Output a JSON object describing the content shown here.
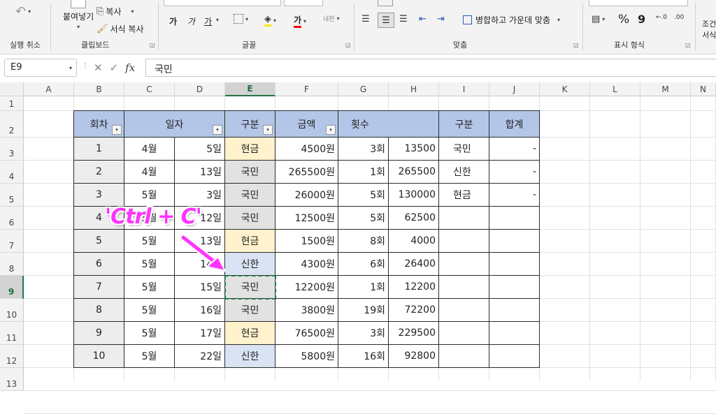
{
  "ribbon": {
    "undo_label": "실행 취소",
    "clipboard": {
      "paste_label": "붙여넣기",
      "copy_label": "복사",
      "format_painter_label": "서식 복사",
      "group_label": "클립보드"
    },
    "font": {
      "group_label": "글꼴",
      "bold_glyph": "가",
      "italic_glyph": "가",
      "underline_glyph": "가",
      "font_color_glyph": "가",
      "phonetic_glyph": "내천"
    },
    "alignment": {
      "group_label": "맞춤",
      "merge_label": "병합하고 가운데 맞춤"
    },
    "number": {
      "group_label": "표시 형식",
      "percent": "%",
      "comma": "9"
    },
    "styles": {
      "label_top": "조건",
      "label_bottom": "서식"
    },
    "colors": {
      "accent": "#217346",
      "font_red": "#ff0000"
    }
  },
  "formula_bar": {
    "name_box": "E9",
    "formula": "국민",
    "fx": "fx"
  },
  "columns": [
    "A",
    "B",
    "C",
    "D",
    "E",
    "F",
    "G",
    "H",
    "I",
    "J",
    "K",
    "L",
    "M",
    "N"
  ],
  "rows": [
    "1",
    "2",
    "3",
    "4",
    "5",
    "6",
    "7",
    "8",
    "9",
    "10",
    "11",
    "12",
    "13"
  ],
  "selected_cell": {
    "column": "E",
    "row": "9"
  },
  "table": {
    "headers": {
      "round": "회차",
      "date": "일자",
      "type": "구분",
      "amount": "금액",
      "count": "횟수",
      "type2": "구분",
      "total": "합계"
    },
    "rows": [
      {
        "no": "1",
        "month": "4월",
        "day": "5일",
        "type": "현금",
        "amount": "4500원",
        "count": "3회",
        "calc": "13500"
      },
      {
        "no": "2",
        "month": "4월",
        "day": "13일",
        "type": "국민",
        "amount": "265500원",
        "count": "1회",
        "calc": "265500"
      },
      {
        "no": "3",
        "month": "5월",
        "day": "3일",
        "type": "국민",
        "amount": "26000원",
        "count": "5회",
        "calc": "130000"
      },
      {
        "no": "4",
        "month": "5월",
        "day": "12일",
        "type": "국민",
        "amount": "12500원",
        "count": "5회",
        "calc": "62500"
      },
      {
        "no": "5",
        "month": "5월",
        "day": "13일",
        "type": "현금",
        "amount": "1500원",
        "count": "8회",
        "calc": "4000"
      },
      {
        "no": "6",
        "month": "5월",
        "day": "14일",
        "type": "신한",
        "amount": "4300원",
        "count": "6회",
        "calc": "26400"
      },
      {
        "no": "7",
        "month": "5월",
        "day": "15일",
        "type": "국민",
        "amount": "12200원",
        "count": "1회",
        "calc": "12200"
      },
      {
        "no": "8",
        "month": "5월",
        "day": "16일",
        "type": "국민",
        "amount": "3800원",
        "count": "19회",
        "calc": "72200"
      },
      {
        "no": "9",
        "month": "5월",
        "day": "17일",
        "type": "현금",
        "amount": "76500원",
        "count": "3회",
        "calc": "229500"
      },
      {
        "no": "10",
        "month": "5월",
        "day": "22일",
        "type": "신한",
        "amount": "5800원",
        "count": "16회",
        "calc": "92800"
      }
    ],
    "summary": [
      {
        "type": "국민",
        "total": "-"
      },
      {
        "type": "신한",
        "total": "-"
      },
      {
        "type": "현금",
        "total": "-"
      }
    ]
  },
  "annotation": {
    "text": "'Ctrl + C'",
    "color": "#ff33ff"
  }
}
